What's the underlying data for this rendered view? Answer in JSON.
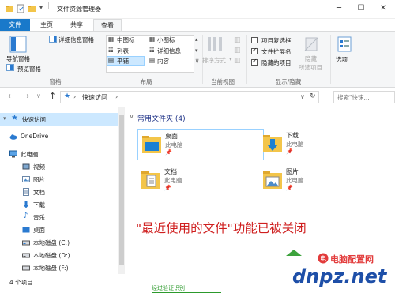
{
  "window": {
    "title": "文件资源管理器",
    "minimize": "─",
    "maximize": "☐",
    "close": "✕"
  },
  "tabs": [
    "文件",
    "主页",
    "共享",
    "查看"
  ],
  "ribbon": {
    "panes": {
      "label": "窗格",
      "nav_pane": "导航窗格",
      "preview_pane": "预览窗格",
      "details_pane": "详细信息窗格"
    },
    "layout": {
      "label": "布局",
      "medium_icons": "中图标",
      "small_icons": "小图标",
      "list": "列表",
      "details": "详细信息",
      "tiles": "平铺",
      "content": "内容"
    },
    "current_view": {
      "label": "当前视图",
      "sort_by": "排序方式"
    },
    "show_hide": {
      "label": "显示/隐藏",
      "item_checkboxes": "项目复选框",
      "file_extensions": "文件扩展名",
      "hidden_items": "隐藏的项目",
      "hide_selected": "隐藏",
      "hide_selected_2": "所选项目"
    },
    "options": "选项"
  },
  "address": {
    "path_root": "快速访问",
    "sep": "›",
    "search_placeholder": "搜索\"快速...",
    "back": "←",
    "forward": "→",
    "recent": "∨",
    "up": "↑",
    "refresh": "↻"
  },
  "nav": [
    {
      "label": "快速访问",
      "icon": "star-icon"
    },
    {
      "label": "OneDrive",
      "icon": "cloud-icon"
    },
    {
      "label": "此电脑",
      "icon": "computer-icon"
    },
    {
      "label": "视频",
      "icon": "video-icon"
    },
    {
      "label": "图片",
      "icon": "picture-icon"
    },
    {
      "label": "文档",
      "icon": "document-icon"
    },
    {
      "label": "下载",
      "icon": "download-icon"
    },
    {
      "label": "音乐",
      "icon": "music-icon"
    },
    {
      "label": "桌面",
      "icon": "desktop-icon"
    },
    {
      "label": "本地磁盘 (C:)",
      "icon": "drive-icon"
    },
    {
      "label": "本地磁盘 (D:)",
      "icon": "drive-icon"
    },
    {
      "label": "本地磁盘 (F:)",
      "icon": "drive-icon"
    }
  ],
  "content": {
    "section_title": "常用文件夹 (4)",
    "folders": [
      {
        "name": "桌面",
        "location": "此电脑",
        "pin": "📌"
      },
      {
        "name": "下载",
        "location": "此电脑",
        "pin": "📌"
      },
      {
        "name": "文档",
        "location": "此电脑",
        "pin": "📌"
      },
      {
        "name": "图片",
        "location": "此电脑",
        "pin": "📌"
      }
    ],
    "overlay_text": "\"最近使用的文件\"功能已被关闭"
  },
  "status": {
    "item_count": "4 个项目",
    "link_text": "经过验证识别"
  },
  "watermark": {
    "text1": "电脑配置网",
    "text2": "dnpz.net"
  },
  "colors": {
    "accent": "#1979ca",
    "overlay": "#cf1f1f",
    "selection": "#cce8ff"
  }
}
